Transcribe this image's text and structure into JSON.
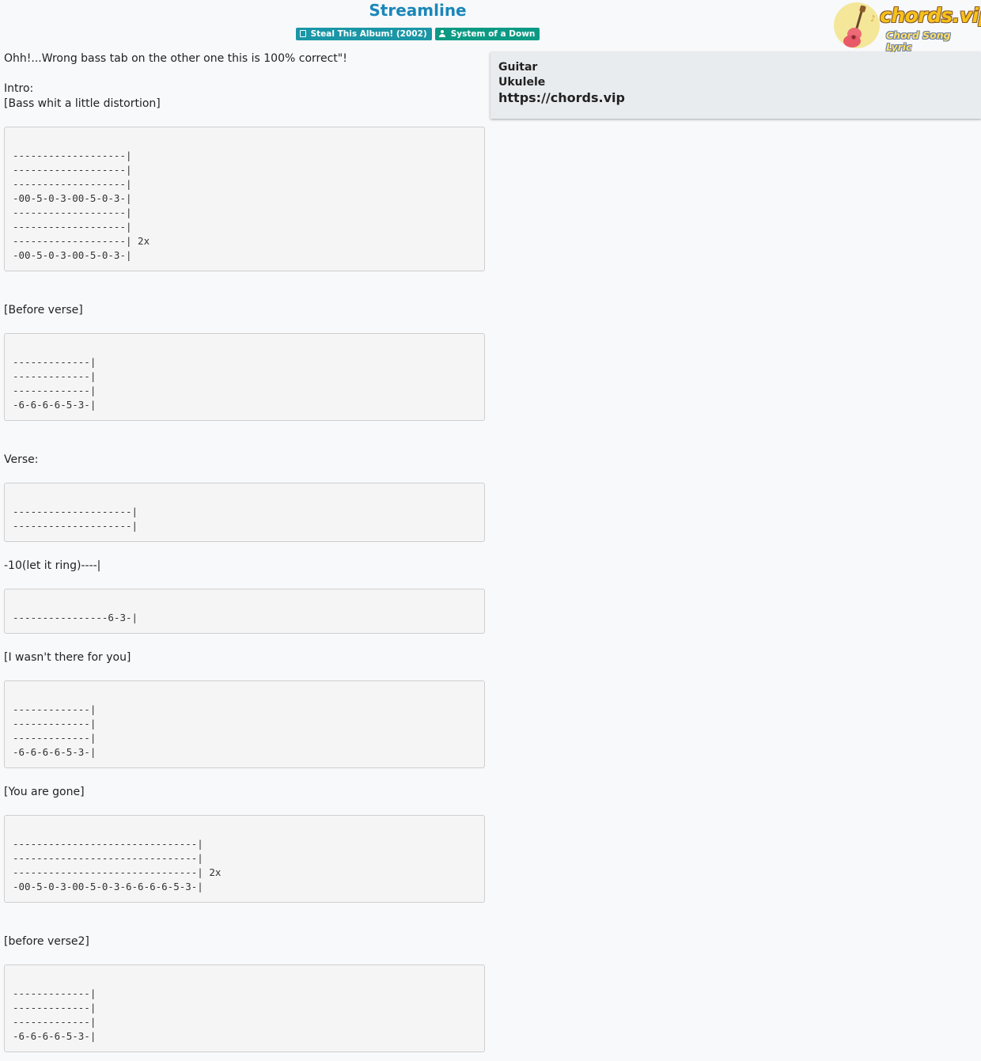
{
  "song": {
    "title": "Streamline",
    "album": "Steal This Album! (2002)",
    "artist": "System of a Down"
  },
  "logo": {
    "text": "chords.vip",
    "sub": "Chord Song Lyric"
  },
  "sidebar": {
    "items": [
      "Guitar",
      "Ukulele"
    ],
    "url": "https://chords.vip"
  },
  "content": {
    "intro_note": "Ohh!...Wrong bass tab on the other one this is 100% correct\"!",
    "intro_label": "Intro:",
    "intro_sub": "[Bass whit a little distortion]",
    "tab1": "-------------------|\n-------------------|\n-------------------|\n-00-5-0-3-00-5-0-3-|\n-------------------|\n-------------------|\n-------------------| 2x\n-00-5-0-3-00-5-0-3-|",
    "before_verse": "[Before verse]",
    "tab2": "-------------|\n-------------|\n-------------|\n-6-6-6-6-5-3-|",
    "verse": "Verse:",
    "tab3": "--------------------|\n--------------------|",
    "let_ring": "-10(let it ring)----|",
    "tab4": "----------------6-3-|",
    "wasnt_there": "[I wasn't there for you]",
    "tab5": "-------------|\n-------------|\n-------------|\n-6-6-6-6-5-3-|",
    "you_are_gone": "[You are gone]",
    "tab6": "-------------------------------|\n-------------------------------|\n-------------------------------| 2x\n-00-5-0-3-00-5-0-3-6-6-6-6-5-3-|",
    "before_verse2": "[before verse2]",
    "tab7": "-------------|\n-------------|\n-------------|\n-6-6-6-6-5-3-|"
  },
  "colors": {
    "title": "#1a87b8",
    "album_badge": "#1a96a6",
    "artist_badge": "#0d9a84",
    "sidebar_bg": "#e9ecef"
  },
  "icons": {
    "album": "book-icon",
    "artist": "user-icon",
    "logo": "guitar-icon"
  }
}
